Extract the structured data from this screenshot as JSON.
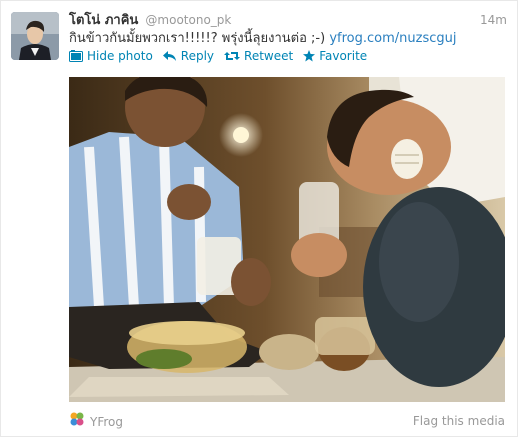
{
  "tweet": {
    "full_name": "โตโน่ ภาคิน",
    "screen_name": "@mootono_pk",
    "timestamp": "14m",
    "text_main": "กินข้าวกันมั้ยพวกเรา!!!!!? พรุ่งนี้ลุยงานต่อ ;-)",
    "link_text": "yfrog.com/nuzscguj"
  },
  "actions": {
    "hide_photo": "Hide photo",
    "reply": "Reply",
    "retweet": "Retweet",
    "favorite": "Favorite",
    "icon_names": [
      "photo-icon",
      "reply-icon",
      "retweet-icon",
      "star-icon"
    ],
    "color": "#0084b4"
  },
  "media": {
    "provider": "YFrog",
    "flag_label": "Flag this media"
  }
}
